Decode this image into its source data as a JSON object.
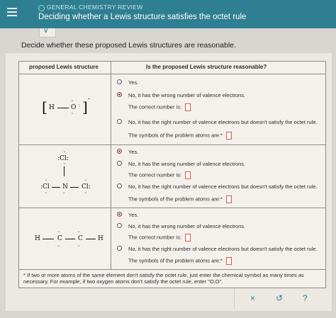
{
  "header": {
    "section": "GENERAL CHEMISTRY REVIEW",
    "title": "Deciding whether a Lewis structure satisfies the octet rule"
  },
  "prompt": "Decide whether these proposed Lewis structures are reasonable.",
  "table": {
    "col1": "proposed Lewis structure",
    "col2": "Is the proposed Lewis structure reasonable?",
    "rows": [
      {
        "structure": {
          "left_bracket": "[",
          "h": "H",
          "o": "O",
          "right_bracket": "]",
          "charge": "-"
        },
        "yes": "Yes.",
        "no_wrong": "No, it has the wrong number of valence electrons.",
        "correct_number": "The correct number is:",
        "no_octet": "No, it has the right number of valence electrons but doesn't satisfy the octet rule.",
        "symbols": "The symbols of the problem atoms are:*",
        "selected": "no_wrong"
      },
      {
        "structure": {
          "cl_top": ":Cl:",
          "cl_left": ":Cl",
          "n": "N",
          "cl_right": "Cl:"
        },
        "yes": "Yes.",
        "no_wrong": "No, it has the wrong number of valence electrons.",
        "correct_number": "The correct number is:",
        "no_octet": "No, it has the right number of valence electrons but doesn't satisfy the octet rule.",
        "symbols": "The symbols of the problem atoms are:*",
        "selected": "yes"
      },
      {
        "structure": {
          "h1": "H",
          "c1": "C",
          "c2": "C",
          "h2": "H"
        },
        "yes": "Yes.",
        "no_wrong": "No, it has the wrong number of valence electrons.",
        "correct_number": "The correct number is:",
        "no_octet": "No, it has the right number of valence electrons but doesn't satisfy the octet rule.",
        "symbols": "The symbols of the problem atoms are:*",
        "selected": "yes"
      }
    ],
    "footnote": "* If two or more atoms of the same element don't satisfy the octet rule, just enter the chemical symbol as many times as necessary. For example, if two oxygen atoms don't satisfy the octet rule, enter \"O,O\"."
  },
  "actions": {
    "clear": "×",
    "undo": "↺",
    "help": "?"
  },
  "colors": {
    "header": "#2f7f93",
    "selected_radio": "#e04a3a"
  }
}
